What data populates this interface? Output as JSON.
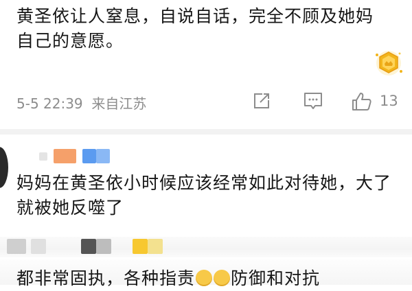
{
  "comments": [
    {
      "text": "黄圣依让人窒息，自说自话，完全不顾及她妈自己的意愿。",
      "time": "5-5 22:39",
      "location": "来自江苏",
      "likes": "13"
    },
    {
      "text": "妈妈在黄圣依小时候应该经常如此对待她，大了就被她反噬了"
    },
    {
      "text_part1": "都非常固执，各种指责",
      "text_part2": "防御和对抗"
    }
  ],
  "icons": {
    "badge": "gold-crown-badge-icon",
    "share": "share-icon",
    "comment": "comment-icon",
    "like": "thumbs-up-icon",
    "emoji": "grin-sweat-emoji-icon"
  },
  "colors": {
    "meta_gray": "#8c8c8c",
    "badge_gold": "#f2b51b",
    "redact_orange": "#f5a06a",
    "redact_blue": "#5b9bf0",
    "redact_yellow": "#f7c830"
  }
}
